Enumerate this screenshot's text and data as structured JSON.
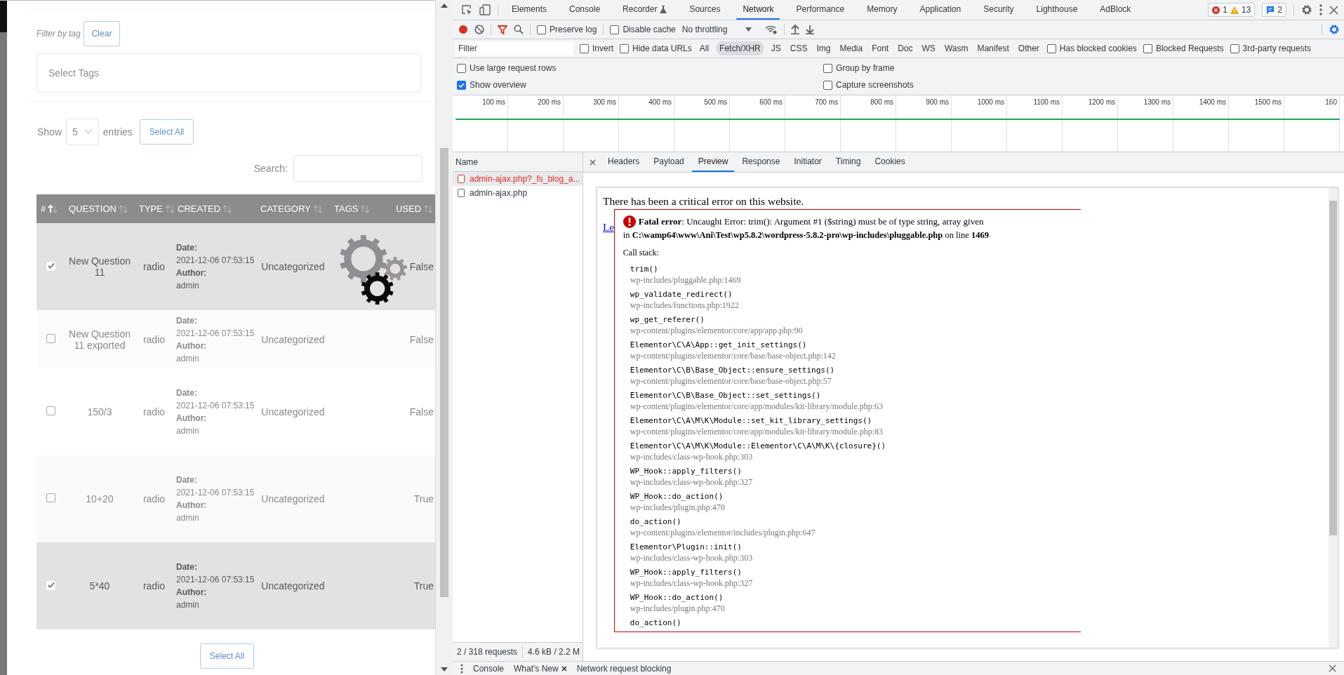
{
  "page": {
    "filter_label": "Filter by tag",
    "clear_button": "Clear",
    "tags_placeholder": "Select Tags",
    "show_label": "Show",
    "entries_value": "5",
    "entries_label": "entries",
    "select_all_top": "Select All",
    "search_label": "Search:",
    "columns": [
      {
        "label": "#",
        "sorted": true
      },
      {
        "label": "QUESTION",
        "sorted": false
      },
      {
        "label": "TYPE",
        "sorted": false
      },
      {
        "label": "CREATED",
        "sorted": false
      },
      {
        "label": "CATEGORY",
        "sorted": false
      },
      {
        "label": "TAGS",
        "sorted": false
      },
      {
        "label": "USED",
        "sorted": false
      }
    ],
    "rows": [
      {
        "selected": true,
        "question": "New Question 11",
        "type": "radio",
        "date_label": "Date:",
        "date": "2021-12-06 07:53:15",
        "author_label": "Author:",
        "author": "admin",
        "category": "Uncategorized",
        "used": "False"
      },
      {
        "selected": false,
        "question": "New Question 11 exported",
        "type": "radio",
        "date_label": "Date:",
        "date": "2021-12-06 07:53:15",
        "author_label": "Author:",
        "author": "admin",
        "category": "Uncategorized",
        "used": "False"
      },
      {
        "selected": false,
        "question": "150/3",
        "type": "radio",
        "date_label": "Date:",
        "date": "2021-12-06 07:53:15",
        "author_label": "Author:",
        "author": "admin",
        "category": "Uncategorized",
        "used": "False"
      },
      {
        "selected": false,
        "question": "10+20",
        "type": "radio",
        "date_label": "Date:",
        "date": "2021-12-06 07:53:15",
        "author_label": "Author:",
        "author": "admin",
        "category": "Uncategorized",
        "used": "True"
      },
      {
        "selected": true,
        "question": "5*40",
        "type": "radio",
        "date_label": "Date:",
        "date": "2021-12-06 07:53:15",
        "author_label": "Author:",
        "author": "admin",
        "category": "Uncategorized",
        "used": "True"
      }
    ],
    "select_all_bottom": "Select All"
  },
  "devtools": {
    "tabs": [
      {
        "label": "Elements",
        "selected": false,
        "experimental": false
      },
      {
        "label": "Console",
        "selected": false,
        "experimental": false
      },
      {
        "label": "Recorder",
        "selected": false,
        "experimental": true
      },
      {
        "label": "Sources",
        "selected": false,
        "experimental": false
      },
      {
        "label": "Network",
        "selected": true,
        "experimental": false
      },
      {
        "label": "Performance",
        "selected": false,
        "experimental": false
      },
      {
        "label": "Memory",
        "selected": false,
        "experimental": false
      },
      {
        "label": "Application",
        "selected": false,
        "experimental": false
      },
      {
        "label": "Security",
        "selected": false,
        "experimental": false
      },
      {
        "label": "Lighthouse",
        "selected": false,
        "experimental": false
      },
      {
        "label": "AdBlock",
        "selected": false,
        "experimental": false
      }
    ],
    "issues": {
      "errors": "1",
      "warnings": "13",
      "messages": "2"
    },
    "toolbar": {
      "recording": true,
      "preserve_log": {
        "label": "Preserve log",
        "checked": false
      },
      "disable_cache": {
        "label": "Disable cache",
        "checked": false
      },
      "throttling": "No throttling"
    },
    "filter": {
      "placeholder": "Filter",
      "invert": {
        "label": "Invert",
        "checked": false
      },
      "hide_data_urls": {
        "label": "Hide data URLs",
        "checked": false
      },
      "types": [
        {
          "label": "All",
          "selected": false
        },
        {
          "label": "Fetch/XHR",
          "selected": true
        },
        {
          "label": "JS",
          "selected": false
        },
        {
          "label": "CSS",
          "selected": false
        },
        {
          "label": "Img",
          "selected": false
        },
        {
          "label": "Media",
          "selected": false
        },
        {
          "label": "Font",
          "selected": false
        },
        {
          "label": "Doc",
          "selected": false
        },
        {
          "label": "WS",
          "selected": false
        },
        {
          "label": "Wasm",
          "selected": false
        },
        {
          "label": "Manifest",
          "selected": false
        },
        {
          "label": "Other",
          "selected": false
        }
      ],
      "extras": [
        {
          "label": "Has blocked cookies",
          "checked": false
        },
        {
          "label": "Blocked Requests",
          "checked": false
        },
        {
          "label": "3rd-party requests",
          "checked": false
        }
      ]
    },
    "options_left": [
      {
        "label": "Use large request rows",
        "checked": false
      },
      {
        "label": "Show overview",
        "checked": true
      }
    ],
    "options_right": [
      {
        "label": "Group by frame",
        "checked": false
      },
      {
        "label": "Capture screenshots",
        "checked": false
      }
    ],
    "overview_ticks": [
      "100 ms",
      "200 ms",
      "300 ms",
      "400 ms",
      "500 ms",
      "600 ms",
      "700 ms",
      "800 ms",
      "900 ms",
      "1000 ms",
      "1100 ms",
      "1200 ms",
      "1300 ms",
      "1400 ms",
      "1500 ms",
      "160"
    ],
    "requests": {
      "header": "Name",
      "items": [
        {
          "name": "admin-ajax.php?_fs_blog_a...",
          "selected": true,
          "failed": true
        },
        {
          "name": "admin-ajax.php",
          "selected": false,
          "failed": false
        }
      ],
      "count": "2 / 318 requests",
      "size": "4.6 kB / 2.2 M"
    },
    "detail_tabs": [
      {
        "label": "Headers",
        "selected": false
      },
      {
        "label": "Payload",
        "selected": false
      },
      {
        "label": "Preview",
        "selected": true
      },
      {
        "label": "Response",
        "selected": false
      },
      {
        "label": "Initiator",
        "selected": false
      },
      {
        "label": "Timing",
        "selected": false
      },
      {
        "label": "Cookies",
        "selected": false
      }
    ],
    "preview": {
      "heading": "There has been a critical error on this website.",
      "link": "Le",
      "message": "**Fatal error**: Uncaught Error: trim(): Argument #1 ($string) must be of type string, array given",
      "location": "in **C:\\wamp64\\www\\Ani\\Test\\wp5.8.2\\wordpress-5.8.2-pro\\wp-includes\\pluggable.php** on line **1469**",
      "call_stack_label": "Call stack:",
      "stack": [
        {
          "fn": "trim()",
          "file": "wp-includes/pluggable.php:1469"
        },
        {
          "fn": "wp_validate_redirect()",
          "file": "wp-includes/functions.php:1922"
        },
        {
          "fn": "wp_get_referer()",
          "file": "wp-content/plugins/elementor/core/app/app.php:90"
        },
        {
          "fn": "Elementor\\C\\A\\App::get_init_settings()",
          "file": "wp-content/plugins/elementor/core/base/base-object.php:142"
        },
        {
          "fn": "Elementor\\C\\B\\Base_Object::ensure_settings()",
          "file": "wp-content/plugins/elementor/core/base/base-object.php:57"
        },
        {
          "fn": "Elementor\\C\\B\\Base_Object::set_settings()",
          "file": "wp-content/plugins/elementor/core/app/modules/kit-library/module.php:63"
        },
        {
          "fn": "Elementor\\C\\A\\M\\K\\Module::set_kit_library_settings()",
          "file": "wp-content/plugins/elementor/core/app/modules/kit-library/module.php:83"
        },
        {
          "fn": "Elementor\\C\\A\\M\\K\\Module::Elementor\\C\\A\\M\\K\\{closure}()",
          "file": "wp-includes/class-wp-hook.php:303"
        },
        {
          "fn": "WP_Hook::apply_filters()",
          "file": "wp-includes/class-wp-hook.php:327"
        },
        {
          "fn": "WP_Hook::do_action()",
          "file": "wp-includes/plugin.php:470"
        },
        {
          "fn": "do_action()",
          "file": "wp-content/plugins/elementor/includes/plugin.php:647"
        },
        {
          "fn": "Elementor\\Plugin::init()",
          "file": "wp-includes/class-wp-hook.php:303"
        },
        {
          "fn": "WP_Hook::apply_filters()",
          "file": "wp-includes/class-wp-hook.php:327"
        },
        {
          "fn": "WP_Hook::do_action()",
          "file": "wp-includes/plugin.php:470"
        },
        {
          "fn": "do_action()"
        }
      ]
    },
    "drawer_tabs": [
      {
        "label": "Console",
        "closable": false
      },
      {
        "label": "What's New",
        "closable": true
      },
      {
        "label": "Network request blocking",
        "closable": false
      }
    ]
  }
}
